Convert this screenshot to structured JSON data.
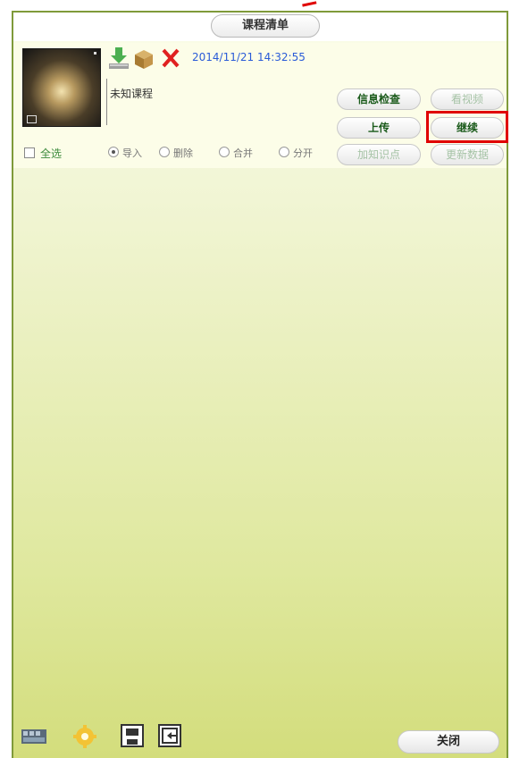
{
  "window": {
    "title": "课程清单"
  },
  "course": {
    "timestamp": "2014/11/21 14:32:55",
    "name": "未知课程",
    "buttons": {
      "detail": "信息检查",
      "upload": "上传",
      "add_point": "加知识点",
      "watch": "看视频",
      "continue": "继续",
      "update": "更新数据"
    }
  },
  "selection": {
    "select_all": "全选",
    "radios": [
      {
        "label": "导入",
        "checked": true
      },
      {
        "label": "删除",
        "checked": false
      },
      {
        "label": "合并",
        "checked": false
      },
      {
        "label": "分开",
        "checked": false
      }
    ]
  },
  "footer": {
    "close_label": "关闭"
  },
  "icons": {
    "download": "download-icon",
    "package": "package-icon",
    "delete": "close-icon",
    "film": "film-icon",
    "settings": "gear-icon",
    "save": "save-icon",
    "import": "import-icon"
  },
  "colors": {
    "accent_green": "#7f9a3a",
    "timestamp_blue": "#2a5bd7",
    "highlight_red": "#e00000"
  }
}
